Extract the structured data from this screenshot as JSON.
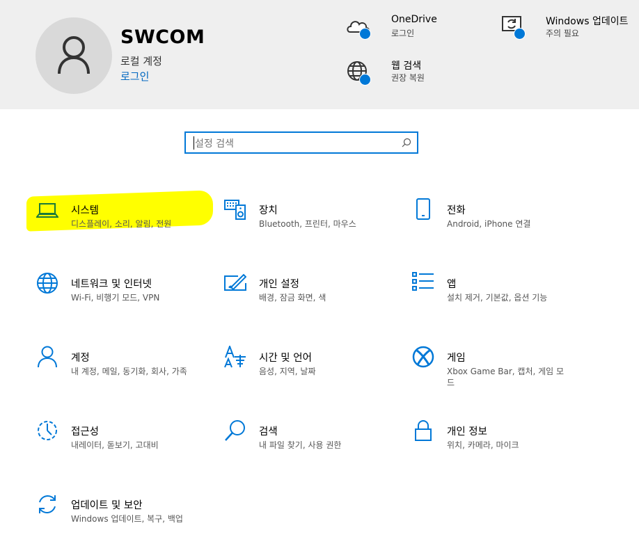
{
  "colors": {
    "accent": "#0078d7",
    "header_bg": "#efefef",
    "highlight": "#ffff00"
  },
  "user": {
    "name": "SWCOM",
    "account_type": "로컬 계정",
    "signin_link": "로그인"
  },
  "header_items": {
    "onedrive": {
      "title": "OneDrive",
      "subtitle": "로그인",
      "icon": "cloud-icon"
    },
    "windows_update": {
      "title": "Windows 업데이트",
      "subtitle": "주의 필요",
      "icon": "update-icon"
    },
    "web_search": {
      "title": "웹 검색",
      "subtitle": "권장 복원",
      "icon": "globe-icon"
    }
  },
  "search": {
    "placeholder": "설정 검색",
    "icon": "search-icon"
  },
  "tiles": [
    {
      "title": "시스템",
      "desc": "디스플레이, 소리, 알림, 전원",
      "icon": "laptop-icon",
      "highlighted": true
    },
    {
      "title": "장치",
      "desc": "Bluetooth, 프린터, 마우스",
      "icon": "keyboard-speaker-icon"
    },
    {
      "title": "전화",
      "desc": "Android, iPhone 연결",
      "icon": "phone-icon"
    },
    {
      "title": "네트워크 및 인터넷",
      "desc": "Wi-Fi, 비행기 모드, VPN",
      "icon": "globe-icon"
    },
    {
      "title": "개인 설정",
      "desc": "배경, 잠금 화면, 색",
      "icon": "paint-icon"
    },
    {
      "title": "앱",
      "desc": "설치 제거, 기본값, 옵션 기능",
      "icon": "apps-list-icon"
    },
    {
      "title": "계정",
      "desc": "내 계정, 메일, 동기화, 회사, 가족",
      "icon": "person-icon"
    },
    {
      "title": "시간 및 언어",
      "desc": "음성, 지역, 날짜",
      "icon": "time-language-icon"
    },
    {
      "title": "게임",
      "desc": "Xbox Game Bar, 캡처, 게임 모드",
      "icon": "xbox-icon"
    },
    {
      "title": "접근성",
      "desc": "내레이터, 돋보기, 고대비",
      "icon": "ease-of-access-icon"
    },
    {
      "title": "검색",
      "desc": "내 파일 찾기, 사용 권한",
      "icon": "search-icon"
    },
    {
      "title": "개인 정보",
      "desc": "위치, 카메라, 마이크",
      "icon": "lock-icon"
    },
    {
      "title": "업데이트 및 보안",
      "desc": "Windows 업데이트, 복구, 백업",
      "icon": "sync-icon"
    }
  ]
}
